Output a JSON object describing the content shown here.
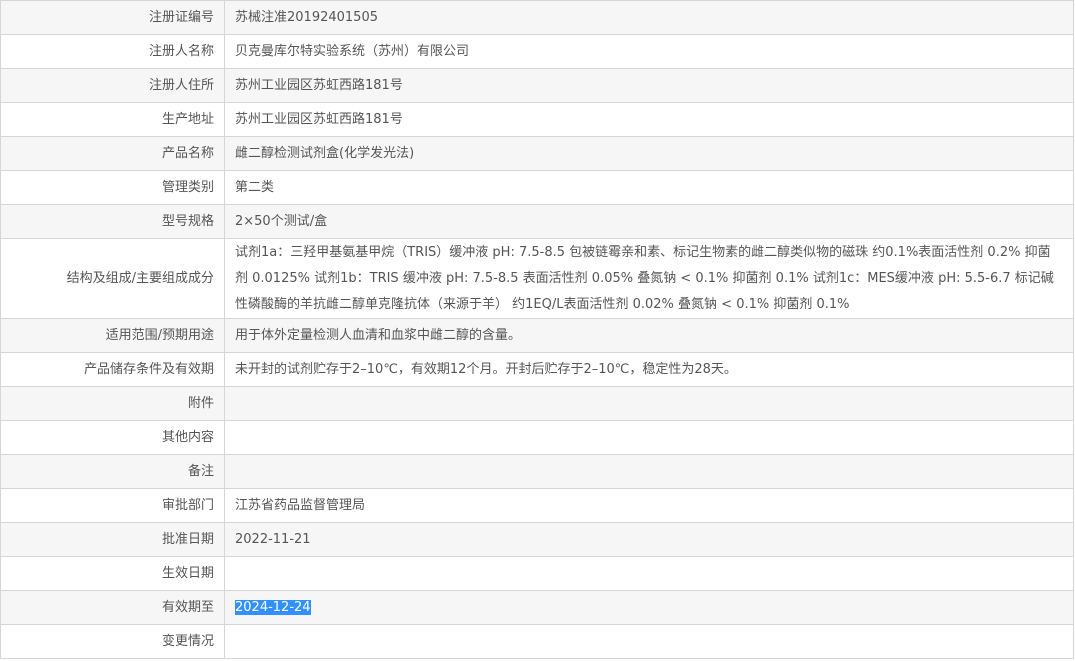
{
  "rows": [
    {
      "label": "注册证编号",
      "value": "苏械注准20192401505"
    },
    {
      "label": "注册人名称",
      "value": "贝克曼库尔特实验系统（苏州）有限公司"
    },
    {
      "label": "注册人住所",
      "value": "苏州工业园区苏虹西路181号"
    },
    {
      "label": "生产地址",
      "value": "苏州工业园区苏虹西路181号"
    },
    {
      "label": "产品名称",
      "value": "雌二醇检测试剂盒(化学发光法)"
    },
    {
      "label": "管理类别",
      "value": "第二类"
    },
    {
      "label": "型号规格",
      "value": "2×50个测试/盒"
    },
    {
      "label": "结构及组成/主要组成成分",
      "value": "试剂1a：三羟甲基氨基甲烷（TRIS）缓冲液 pH: 7.5-8.5 包被链霉亲和素、标记生物素的雌二醇类似物的磁珠 约0.1%表面活性剂 0.2% 抑菌剂 0.0125% 试剂1b：TRIS 缓冲液 pH: 7.5-8.5 表面活性剂 0.05% 叠氮钠 < 0.1% 抑菌剂 0.1% 试剂1c：MES缓冲液 pH: 5.5-6.7 标记碱性磷酸酶的羊抗雌二醇单克隆抗体（来源于羊） 约1EQ/L表面活性剂 0.02% 叠氮钠 < 0.1% 抑菌剂 0.1%"
    },
    {
      "label": "适用范围/预期用途",
      "value": "用于体外定量检测人血清和血浆中雌二醇的含量。"
    },
    {
      "label": "产品储存条件及有效期",
      "value": "未开封的试剂贮存于2–10℃，有效期12个月。开封后贮存于2–10℃，稳定性为28天。"
    },
    {
      "label": "附件",
      "value": ""
    },
    {
      "label": "其他内容",
      "value": ""
    },
    {
      "label": "备注",
      "value": ""
    },
    {
      "label": "审批部门",
      "value": "江苏省药品监督管理局"
    },
    {
      "label": "批准日期",
      "value": "2022-11-21"
    },
    {
      "label": "生效日期",
      "value": ""
    },
    {
      "label": "有效期至",
      "value": "2024-12-24"
    },
    {
      "label": "变更情况",
      "value": ""
    }
  ]
}
